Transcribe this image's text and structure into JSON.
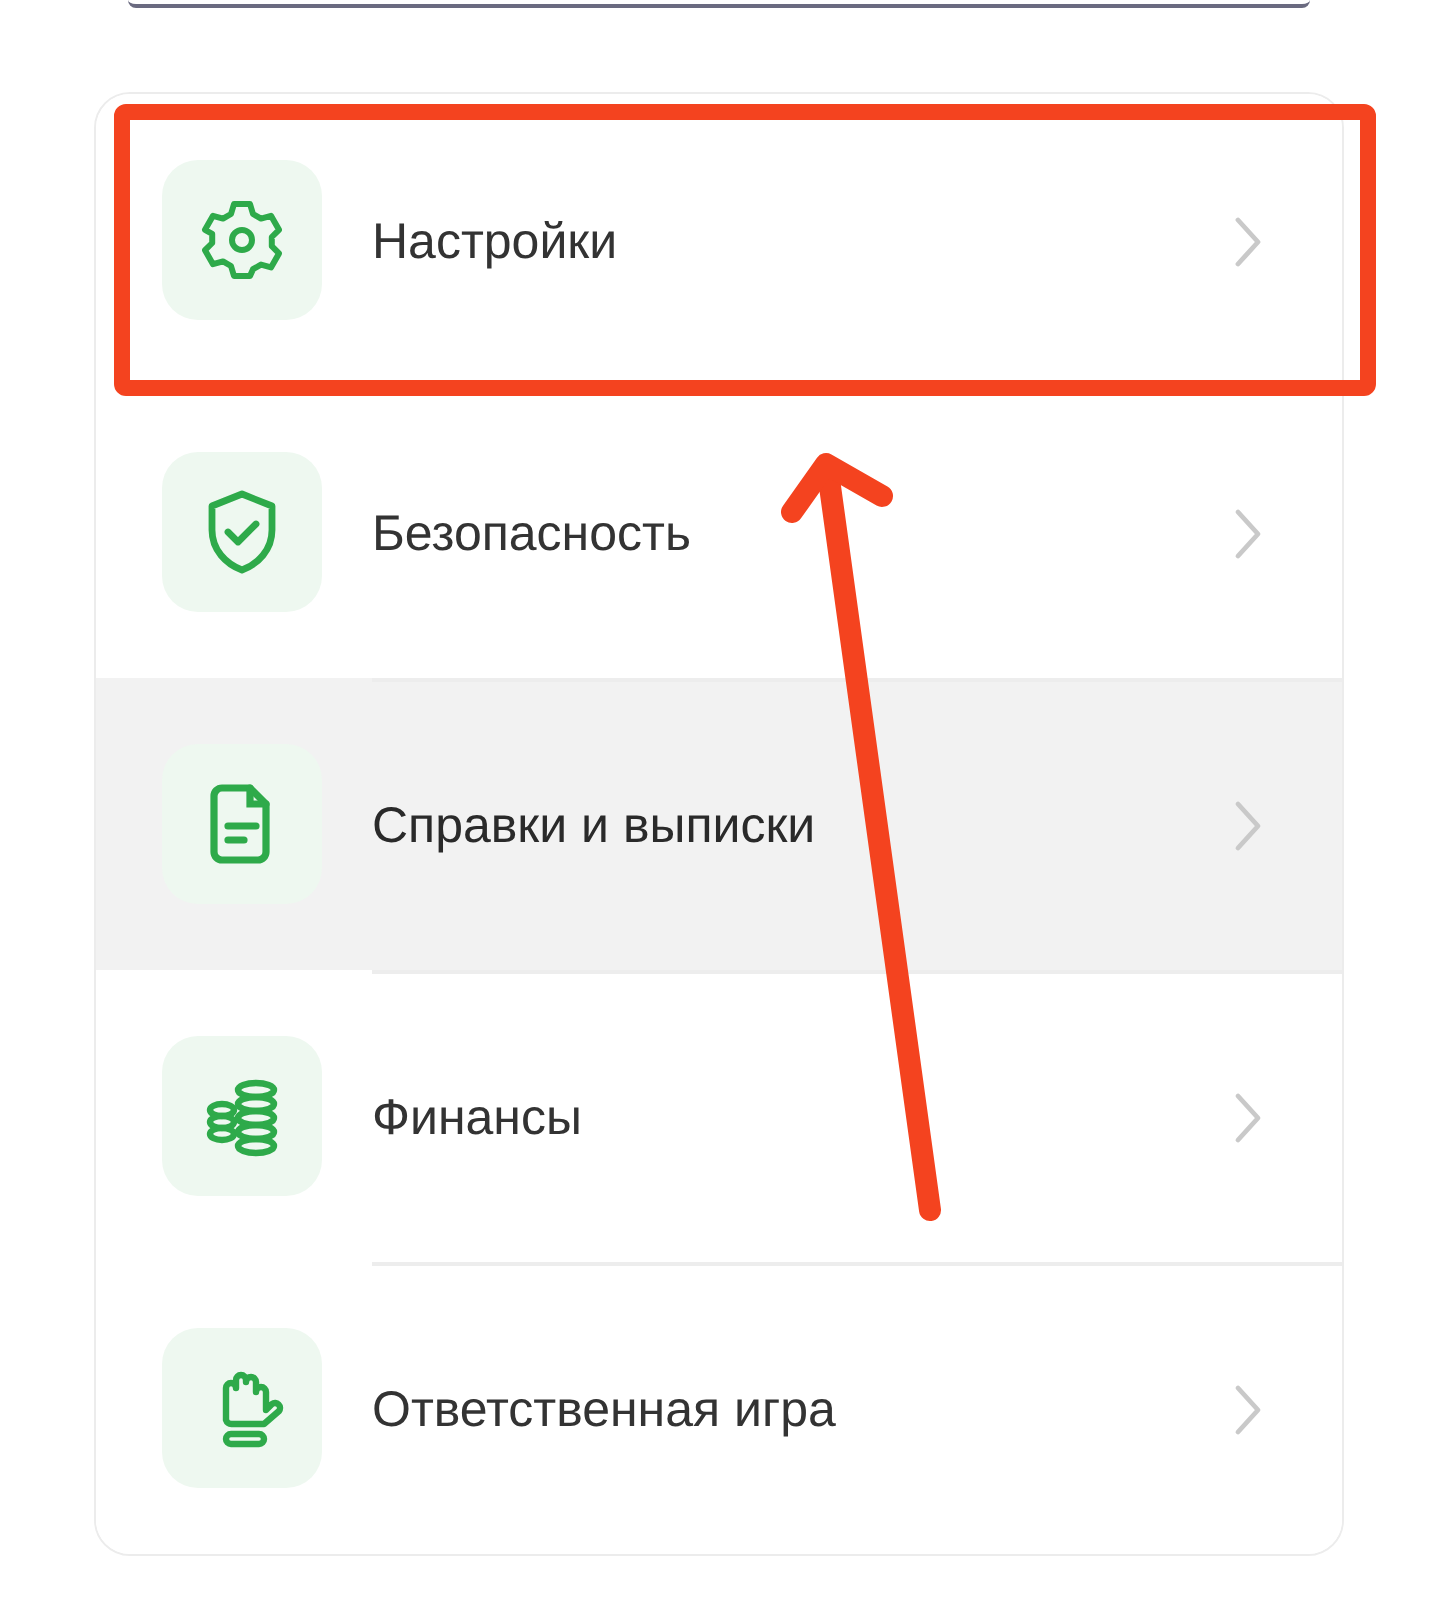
{
  "menu": {
    "items": [
      {
        "kind": "settings",
        "label": "Настройки",
        "selected": false
      },
      {
        "kind": "security",
        "label": "Безопасность",
        "selected": false
      },
      {
        "kind": "documents",
        "label": "Справки и выписки",
        "selected": true
      },
      {
        "kind": "finance",
        "label": "Финансы",
        "selected": false
      },
      {
        "kind": "responsible",
        "label": "Ответственная игра",
        "selected": false
      }
    ]
  }
}
